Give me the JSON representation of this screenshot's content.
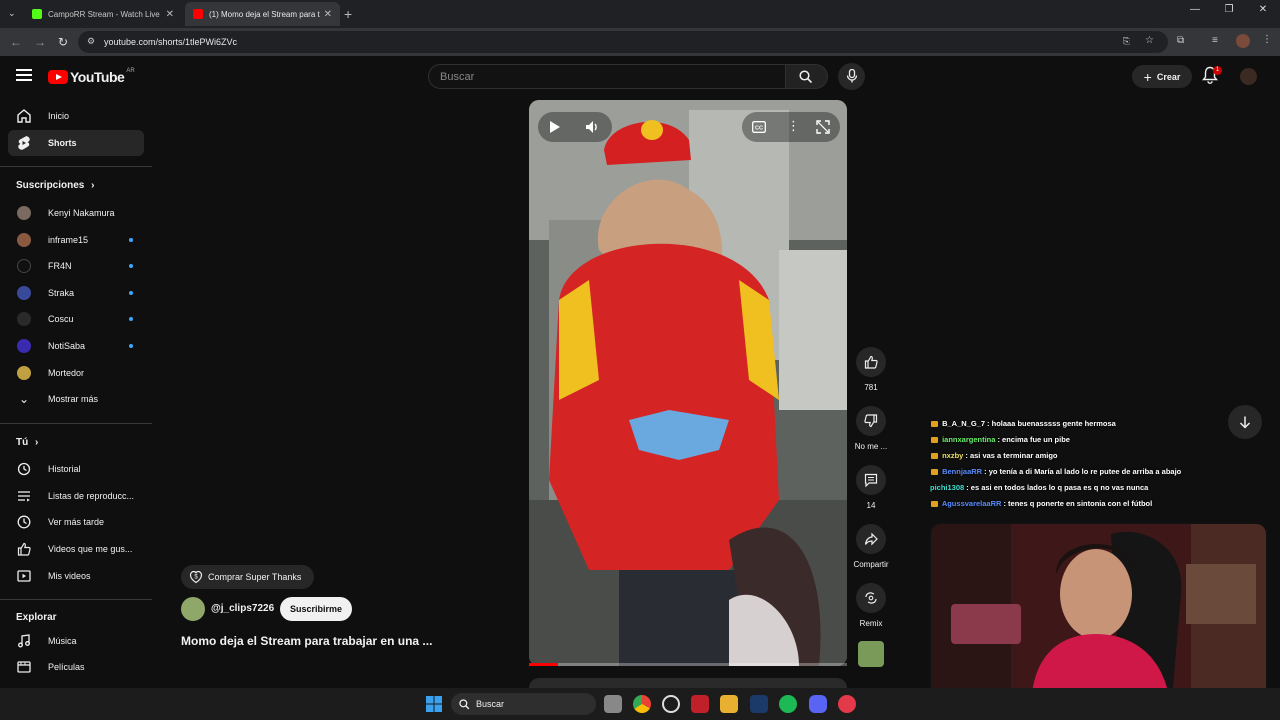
{
  "browser": {
    "tabs": [
      {
        "title": "CampoRR Stream - Watch Live",
        "color": "#53fc18"
      },
      {
        "title": "(1) Momo deja el Stream para t",
        "color": "#ff0000"
      }
    ],
    "url": "youtube.com/shorts/1tlePWi6ZVc"
  },
  "header": {
    "logo_text": "YouTube",
    "region": "AR",
    "search_placeholder": "Buscar",
    "create_label": "Crear",
    "notification_count": "1"
  },
  "sidebar": {
    "main": [
      {
        "label": "Inicio",
        "icon": "home-icon"
      },
      {
        "label": "Shorts",
        "icon": "shorts-icon",
        "active": true
      }
    ],
    "subscriptions_title": "Suscripciones",
    "subscriptions": [
      {
        "label": "Kenyi Nakamura",
        "avatar_color": "#7a6a60",
        "new": false
      },
      {
        "label": "inframe15",
        "avatar_color": "#8a5a40",
        "new": true
      },
      {
        "label": "FR4N",
        "avatar_color": "#111111",
        "new": true
      },
      {
        "label": "Straka",
        "avatar_color": "#3a4a9a",
        "new": true
      },
      {
        "label": "Coscu",
        "avatar_color": "#2a2a2a",
        "new": true
      },
      {
        "label": "NotiSaba",
        "avatar_color": "#3a2ab0",
        "new": true
      },
      {
        "label": "Mortedor",
        "avatar_color": "#c0a040",
        "new": false
      }
    ],
    "show_more": "Mostrar más",
    "you_title": "Tú",
    "you_items": [
      {
        "label": "Historial",
        "icon": "history-icon"
      },
      {
        "label": "Listas de reproducc...",
        "icon": "playlists-icon"
      },
      {
        "label": "Ver más tarde",
        "icon": "watch-later-icon"
      },
      {
        "label": "Videos que me gus...",
        "icon": "liked-videos-icon"
      },
      {
        "label": "Mis videos",
        "icon": "my-videos-icon"
      }
    ],
    "explore_title": "Explorar",
    "explore_items": [
      {
        "label": "Música",
        "icon": "music-icon"
      },
      {
        "label": "Películas",
        "icon": "movies-icon"
      }
    ]
  },
  "short": {
    "super_thanks": "Comprar Super Thanks",
    "channel": "@j_clips7226",
    "subscribe": "Suscribirme",
    "title": "Momo deja el Stream para trabajar en una ...",
    "likes": "781",
    "dislike_label": "No me ...",
    "comments": "14",
    "share_label": "Compartir",
    "remix_label": "Remix",
    "progress": 0.09
  },
  "chat": [
    {
      "user": "B_A_N_G_7",
      "msg": ": holaaa buenasssss gente hermosa",
      "color": "#ffffff",
      "badges": 1
    },
    {
      "user": "iannxargentina",
      "msg": ": encima fue un pibe",
      "color": "#6cf06c",
      "badges": 2
    },
    {
      "user": "nxzby",
      "msg": ": asi vas a terminar amigo",
      "color": "#f0e060",
      "badges": 1
    },
    {
      "user": "BennjaaRR",
      "msg": ": yo tenía a di María al lado lo re putee de arriba a abajo",
      "color": "#5a8cff",
      "badges": 2
    },
    {
      "user": "pichi1308",
      "msg": ": es asi en todos lados lo q pasa es q no vas nunca",
      "color": "#40e0d0",
      "badges": 0
    },
    {
      "user": "AgussvarelaaRR",
      "msg": ": tenes q ponerte en sintonia con el fútbol",
      "color": "#5a8cff",
      "badges": 2
    }
  ],
  "taskbar": {
    "search": "Buscar"
  }
}
